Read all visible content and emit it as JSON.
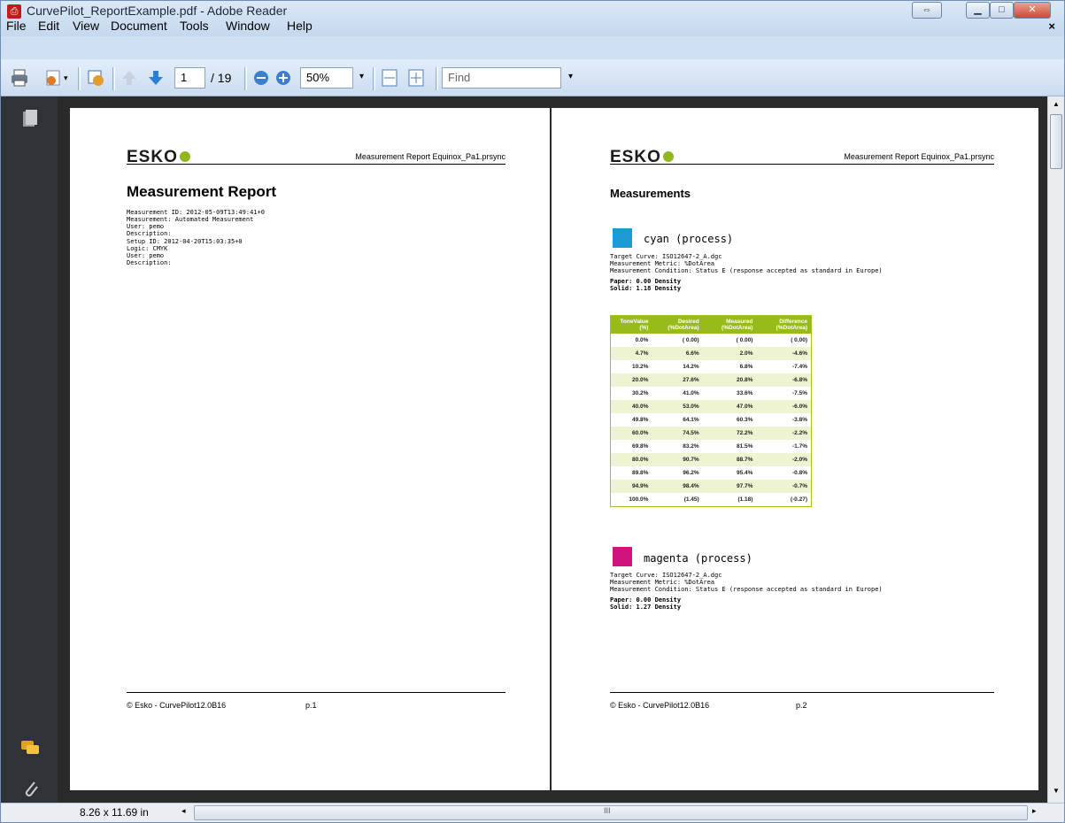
{
  "window": {
    "title": "CurvePilot_ReportExample.pdf - Adobe Reader",
    "close_doc": "×"
  },
  "menu": [
    "File",
    "Edit",
    "View",
    "Document",
    "Tools",
    "Window",
    "Help"
  ],
  "toolbar": {
    "page_current": "1",
    "page_total": "/ 19",
    "zoom": "50%",
    "find_placeholder": "Find",
    "dropdown": "▾"
  },
  "page1": {
    "logo": "ESKO",
    "header_right": "Measurement Report Equinox_Pa1.prsync",
    "title": "Measurement Report",
    "meta1": [
      "Measurement ID: 2012-05-09T13:49:41+0",
      "Measurement: Automated Measurement",
      "User: pemo",
      "Description:"
    ],
    "meta2": [
      "Setup ID: 2012-04-20T15:03:35+0",
      "Logic: CMYK",
      "User: pemo",
      "Description:"
    ],
    "footer_left": "© Esko - CurvePilot12.0B16",
    "footer_page": "p.1"
  },
  "page2": {
    "logo": "ESKO",
    "header_right": "Measurement Report Equinox_Pa1.prsync",
    "title": "Measurements",
    "cyan": {
      "name": "cyan (process)",
      "color": "#1c9ad6",
      "target": "Target Curve: ISO12647-2_A.dgc",
      "metric": "Measurement Metric: %DotArea",
      "condition": "Measurement Condition: Status E (response accepted as standard in Europe)",
      "paper": "Paper: 0.00 Density",
      "solid": "Solid: 1.18 Density"
    },
    "table": {
      "headers": [
        "ToneValue (%)",
        "Desired (%DotArea)",
        "Measured (%DotArea)",
        "Difference (%DotArea)"
      ],
      "rows": [
        [
          "0.0%",
          "( 0.00)",
          "( 0.00)",
          "( 0.00)"
        ],
        [
          "4.7%",
          "6.6%",
          "2.0%",
          "-4.6%"
        ],
        [
          "10.2%",
          "14.2%",
          "6.8%",
          "-7.4%"
        ],
        [
          "20.0%",
          "27.6%",
          "20.8%",
          "-6.8%"
        ],
        [
          "30.2%",
          "41.0%",
          "33.6%",
          "-7.5%"
        ],
        [
          "40.0%",
          "53.0%",
          "47.0%",
          "-6.0%"
        ],
        [
          "49.8%",
          "64.1%",
          "60.3%",
          "-3.8%"
        ],
        [
          "60.0%",
          "74.5%",
          "72.2%",
          "-2.2%"
        ],
        [
          "69.8%",
          "83.2%",
          "81.5%",
          "-1.7%"
        ],
        [
          "80.0%",
          "90.7%",
          "88.7%",
          "-2.0%"
        ],
        [
          "89.8%",
          "96.2%",
          "95.4%",
          "-0.8%"
        ],
        [
          "94.9%",
          "98.4%",
          "97.7%",
          "-0.7%"
        ],
        [
          "100.0%",
          "(1.45)",
          "(1.18)",
          "(-0.27)"
        ]
      ]
    },
    "magenta": {
      "name": "magenta (process)",
      "color": "#d1147d",
      "target": "Target Curve: ISO12647-2_A.dgc",
      "metric": "Measurement Metric: %DotArea",
      "condition": "Measurement Condition: Status E (response accepted as standard in Europe)",
      "paper": "Paper: 0.00 Density",
      "solid": "Solid: 1.27 Density"
    },
    "footer_left": "© Esko - CurvePilot12.0B16",
    "footer_page": "p.2"
  },
  "status": {
    "page_size": "8.26 x 11.69 in",
    "scroll_grip": "III"
  }
}
